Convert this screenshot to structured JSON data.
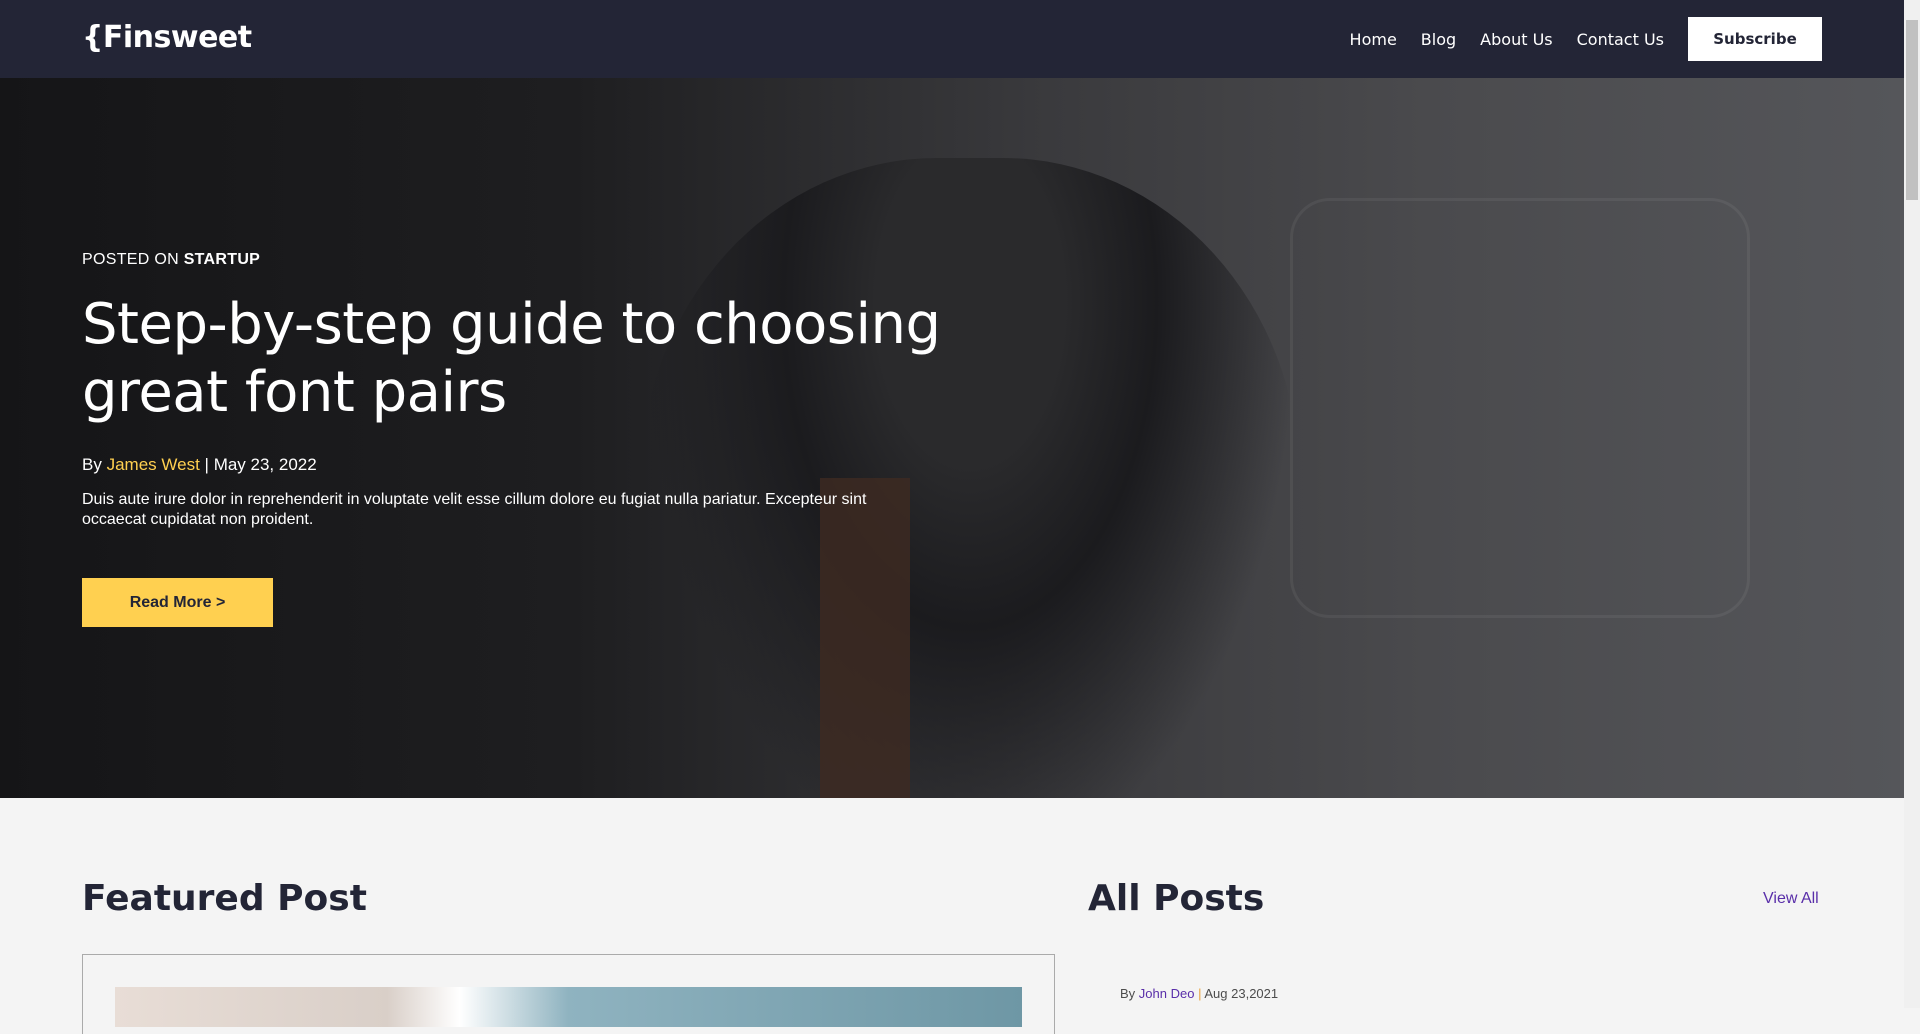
{
  "header": {
    "logo": "{Finsweet",
    "nav": [
      "Home",
      "Blog",
      "About Us",
      "Contact Us"
    ],
    "subscribe": "Subscribe"
  },
  "hero": {
    "posted_prefix": "POSTED ON",
    "category": "STARTUP",
    "title": "Step-by-step guide to choosing great font pairs",
    "by": "By",
    "author": "James West",
    "separator": "|",
    "date": "May 23, 2022",
    "description": "Duis aute irure dolor in reprehenderit in voluptate velit esse cillum dolore eu fugiat nulla pariatur. Excepteur sint occaecat cupidatat non proident.",
    "button": "Read More >"
  },
  "featured": {
    "heading": "Featured Post"
  },
  "all_posts": {
    "heading": "All Posts",
    "view_all": "View All",
    "first_post": {
      "by": "By",
      "author": "John Deo",
      "separator": "|",
      "date": "Aug 23,2021"
    }
  }
}
